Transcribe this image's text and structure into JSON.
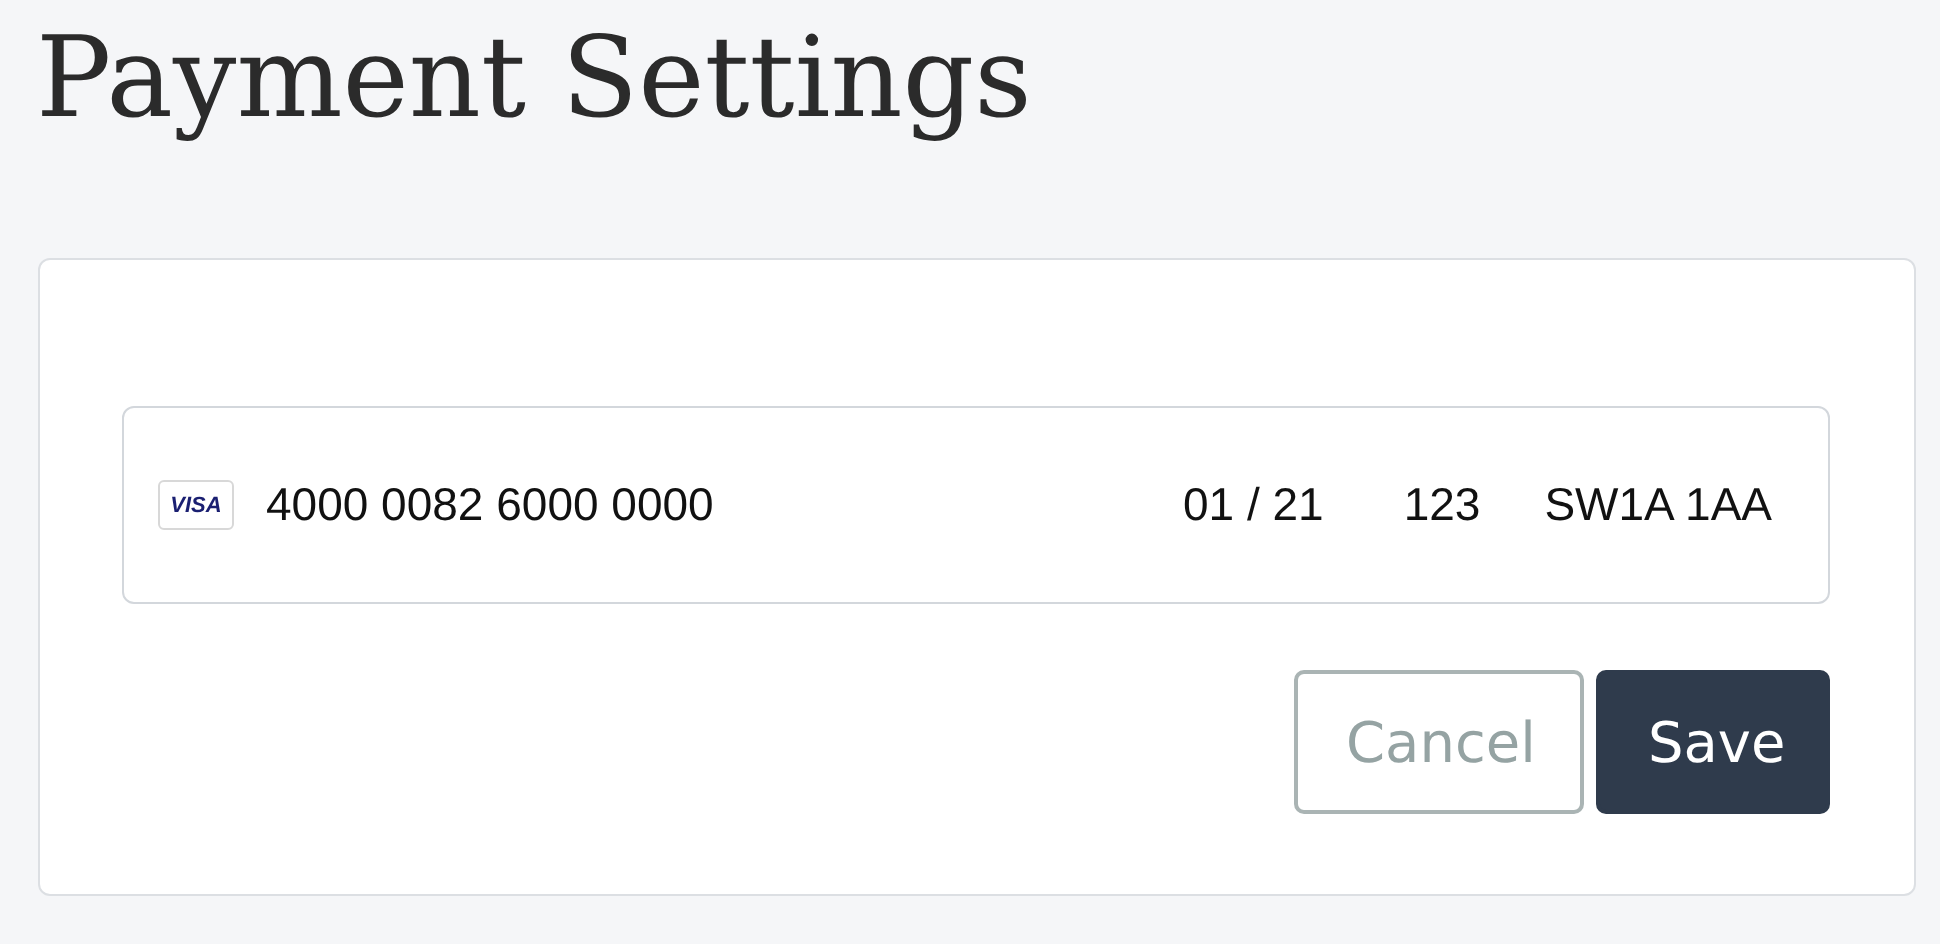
{
  "title": "Payment Settings",
  "card_field": {
    "brand": "VISA",
    "number": "4000 0082 6000 0000",
    "expiry": "01 / 21",
    "cvc": "123",
    "postal_code": "SW1A 1AA"
  },
  "buttons": [
    {
      "label": "Cancel",
      "kind": "secondary"
    },
    {
      "label": "Save",
      "kind": "primary"
    }
  ]
}
